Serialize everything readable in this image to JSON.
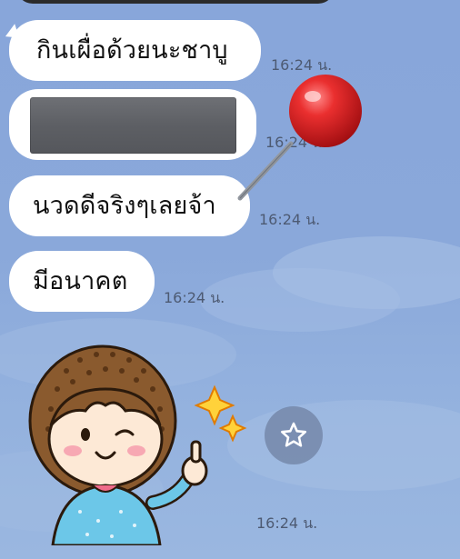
{
  "messages": [
    {
      "text": "กินเผื่อด้วยนะชาบู",
      "time": "16:24 น."
    },
    {
      "kind": "image",
      "time": "16:24 น."
    },
    {
      "text": "นวดดีจริงๆเลยจ้า",
      "time": "16:24 น."
    },
    {
      "text": "มีอนาคต",
      "time": "16:24 น."
    },
    {
      "kind": "sticker",
      "time": "16:24 น."
    }
  ],
  "icons": {
    "star": "star-outline-icon",
    "pin": "pushpin-icon"
  },
  "colors": {
    "background": "#88a6da",
    "bubble": "#ffffff",
    "timestamp": "#4d5a72",
    "pin_head": "#e02a2a"
  }
}
